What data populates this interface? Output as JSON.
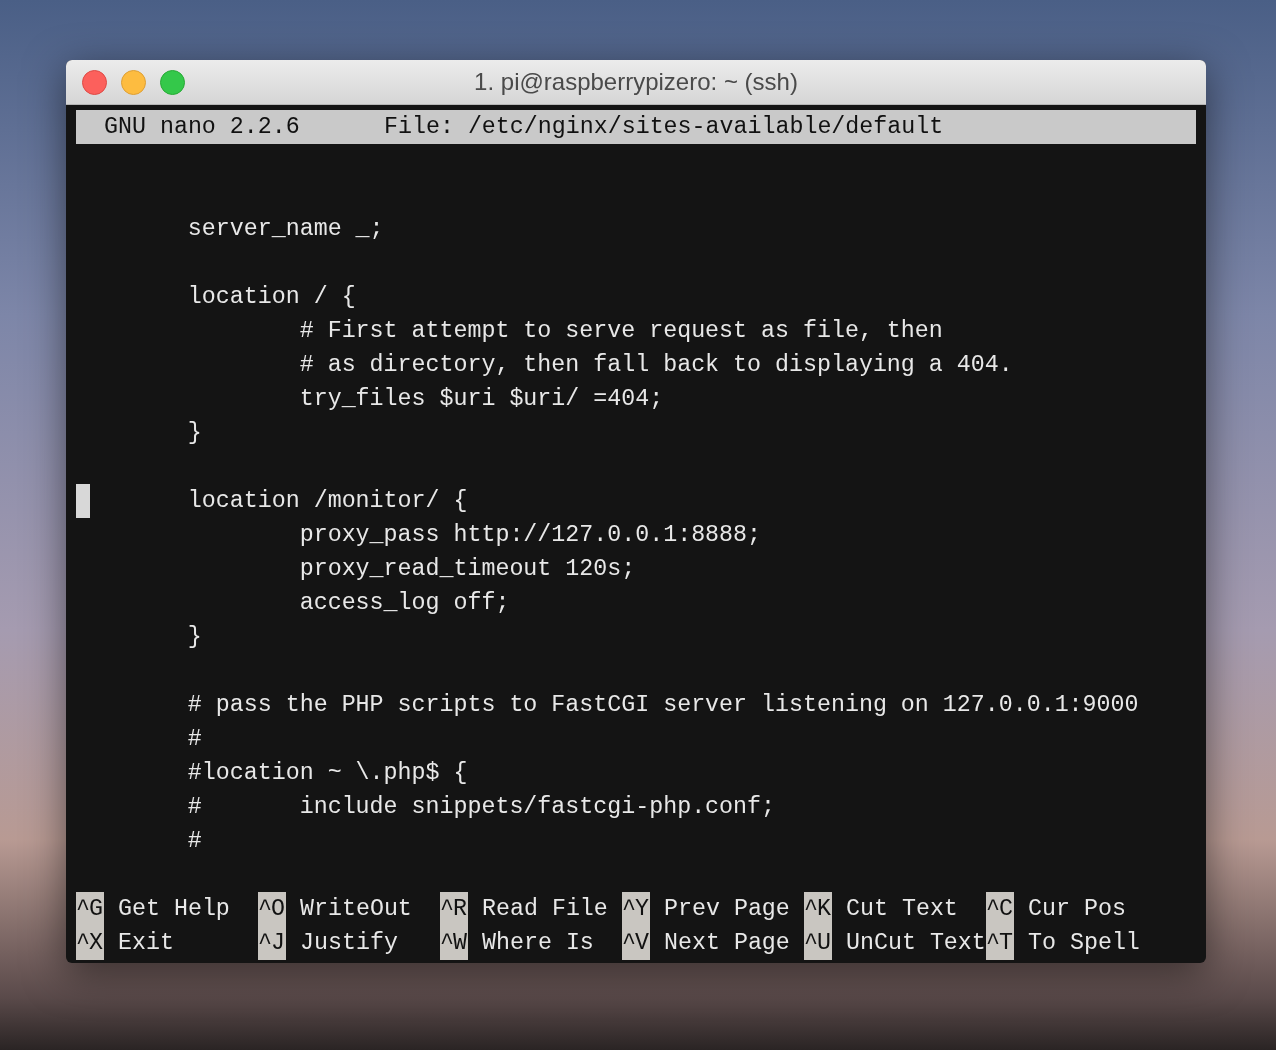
{
  "window": {
    "title": "1. pi@raspberrypizero: ~ (ssh)"
  },
  "header": {
    "program": "GNU nano 2.2.6",
    "file": "File: /etc/nginx/sites-available/default"
  },
  "lines": [
    {
      "kind": "blank"
    },
    {
      "kind": "blank"
    },
    {
      "kind": "text",
      "text": "        server_name _;"
    },
    {
      "kind": "blank"
    },
    {
      "kind": "text",
      "text": "        location / {"
    },
    {
      "kind": "text",
      "text": "                # First attempt to serve request as file, then"
    },
    {
      "kind": "text",
      "text": "                # as directory, then fall back to displaying a 404."
    },
    {
      "kind": "text",
      "text": "                try_files $uri $uri/ =404;"
    },
    {
      "kind": "text",
      "text": "        }"
    },
    {
      "kind": "blank"
    },
    {
      "kind": "text",
      "text": "        location /monitor/ {",
      "cursor": true
    },
    {
      "kind": "text",
      "text": "                proxy_pass http://127.0.0.1:8888;"
    },
    {
      "kind": "text",
      "text": "                proxy_read_timeout 120s;"
    },
    {
      "kind": "text",
      "text": "                access_log off;"
    },
    {
      "kind": "text",
      "text": "        }"
    },
    {
      "kind": "blank"
    },
    {
      "kind": "text",
      "text": "        # pass the PHP scripts to FastCGI server listening on 127.0.0.1:9000"
    },
    {
      "kind": "text",
      "text": "        #"
    },
    {
      "kind": "text",
      "text": "        #location ~ \\.php$ {"
    },
    {
      "kind": "text",
      "text": "        #       include snippets/fastcgi-php.conf;"
    },
    {
      "kind": "text",
      "text": "        #"
    },
    {
      "kind": "blank"
    }
  ],
  "shortcuts": [
    [
      {
        "key": "^G",
        "label": "Get Help"
      },
      {
        "key": "^X",
        "label": "Exit"
      }
    ],
    [
      {
        "key": "^O",
        "label": "WriteOut"
      },
      {
        "key": "^J",
        "label": "Justify"
      }
    ],
    [
      {
        "key": "^R",
        "label": "Read File"
      },
      {
        "key": "^W",
        "label": "Where Is"
      }
    ],
    [
      {
        "key": "^Y",
        "label": "Prev Page"
      },
      {
        "key": "^V",
        "label": "Next Page"
      }
    ],
    [
      {
        "key": "^K",
        "label": "Cut Text"
      },
      {
        "key": "^U",
        "label": "UnCut Text"
      }
    ],
    [
      {
        "key": "^C",
        "label": "Cur Pos"
      },
      {
        "key": "^T",
        "label": "To Spell"
      }
    ]
  ]
}
